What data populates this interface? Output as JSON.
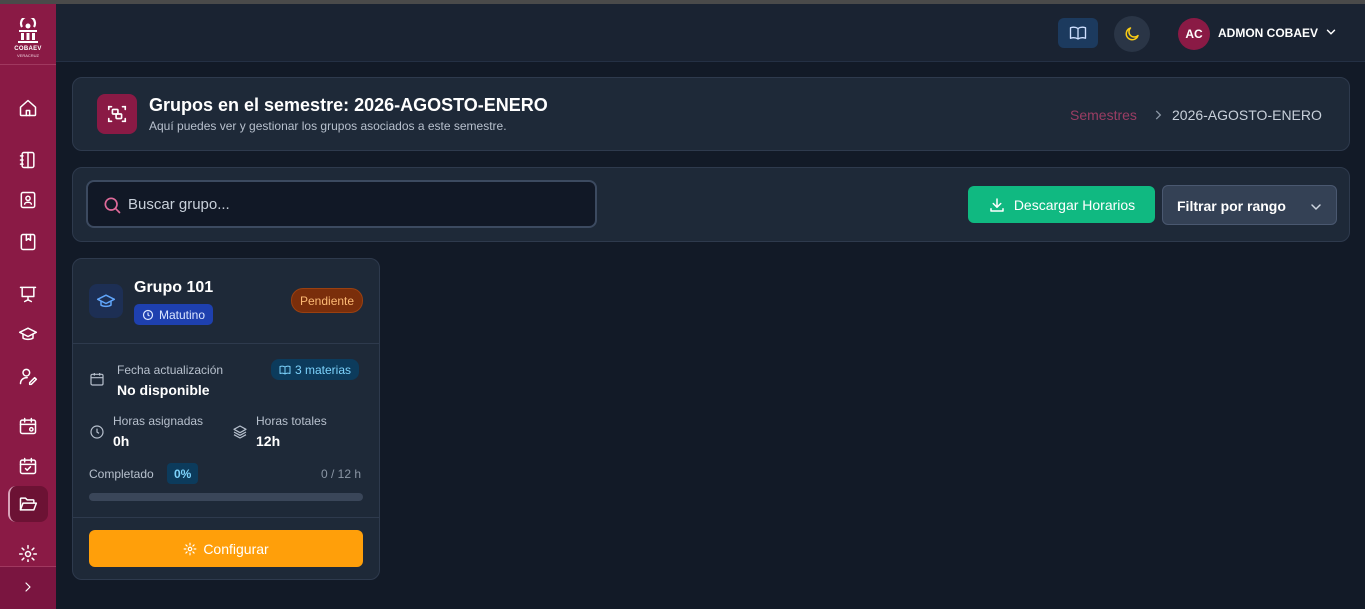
{
  "sidebar": {
    "logo_text": "COBAEV",
    "logo_subtext": "VERACRUZ",
    "items": [
      {
        "icon": "home-icon"
      },
      {
        "icon": "notebook-icon"
      },
      {
        "icon": "contact-book-icon"
      },
      {
        "icon": "bookmark-book-icon"
      },
      {
        "icon": "presentation-icon"
      },
      {
        "icon": "graduation-cap-icon"
      },
      {
        "icon": "user-edit-icon"
      },
      {
        "icon": "calendar-settings-icon"
      },
      {
        "icon": "calendar-check-icon"
      },
      {
        "icon": "folder-open-icon",
        "active": true
      },
      {
        "icon": "gear-icon"
      }
    ],
    "expand_icon": "chevron-right-icon"
  },
  "header": {
    "user_initials": "AC",
    "user_name": "ADMON COBAEV"
  },
  "page": {
    "title": "Grupos en el semestre: 2026-AGOSTO-ENERO",
    "subtitle": "Aquí puedes ver y gestionar los grupos asociados a este semestre.",
    "breadcrumb": {
      "link": "Semestres",
      "current": "2026-AGOSTO-ENERO"
    }
  },
  "toolbar": {
    "search_placeholder": "Buscar grupo...",
    "download_label": "Descargar Horarios",
    "filter_label": "Filtrar por rango"
  },
  "groups": [
    {
      "title": "Grupo 101",
      "shift": "Matutino",
      "status": "Pendiente",
      "updated_label": "Fecha actualización",
      "updated_value": "No disponible",
      "subjects": "3 materias",
      "assigned_label": "Horas asignadas",
      "assigned_value": "0h",
      "total_label": "Horas totales",
      "total_value": "12h",
      "completed_label": "Completado",
      "completed_pct": "0%",
      "progress": 0,
      "ratio": "0 / 12 h",
      "action_label": "Configurar"
    }
  ],
  "colors": {
    "brand": "#8a1a45",
    "success": "#10b981",
    "warning": "#ff9f0a",
    "background": "#121a27"
  }
}
